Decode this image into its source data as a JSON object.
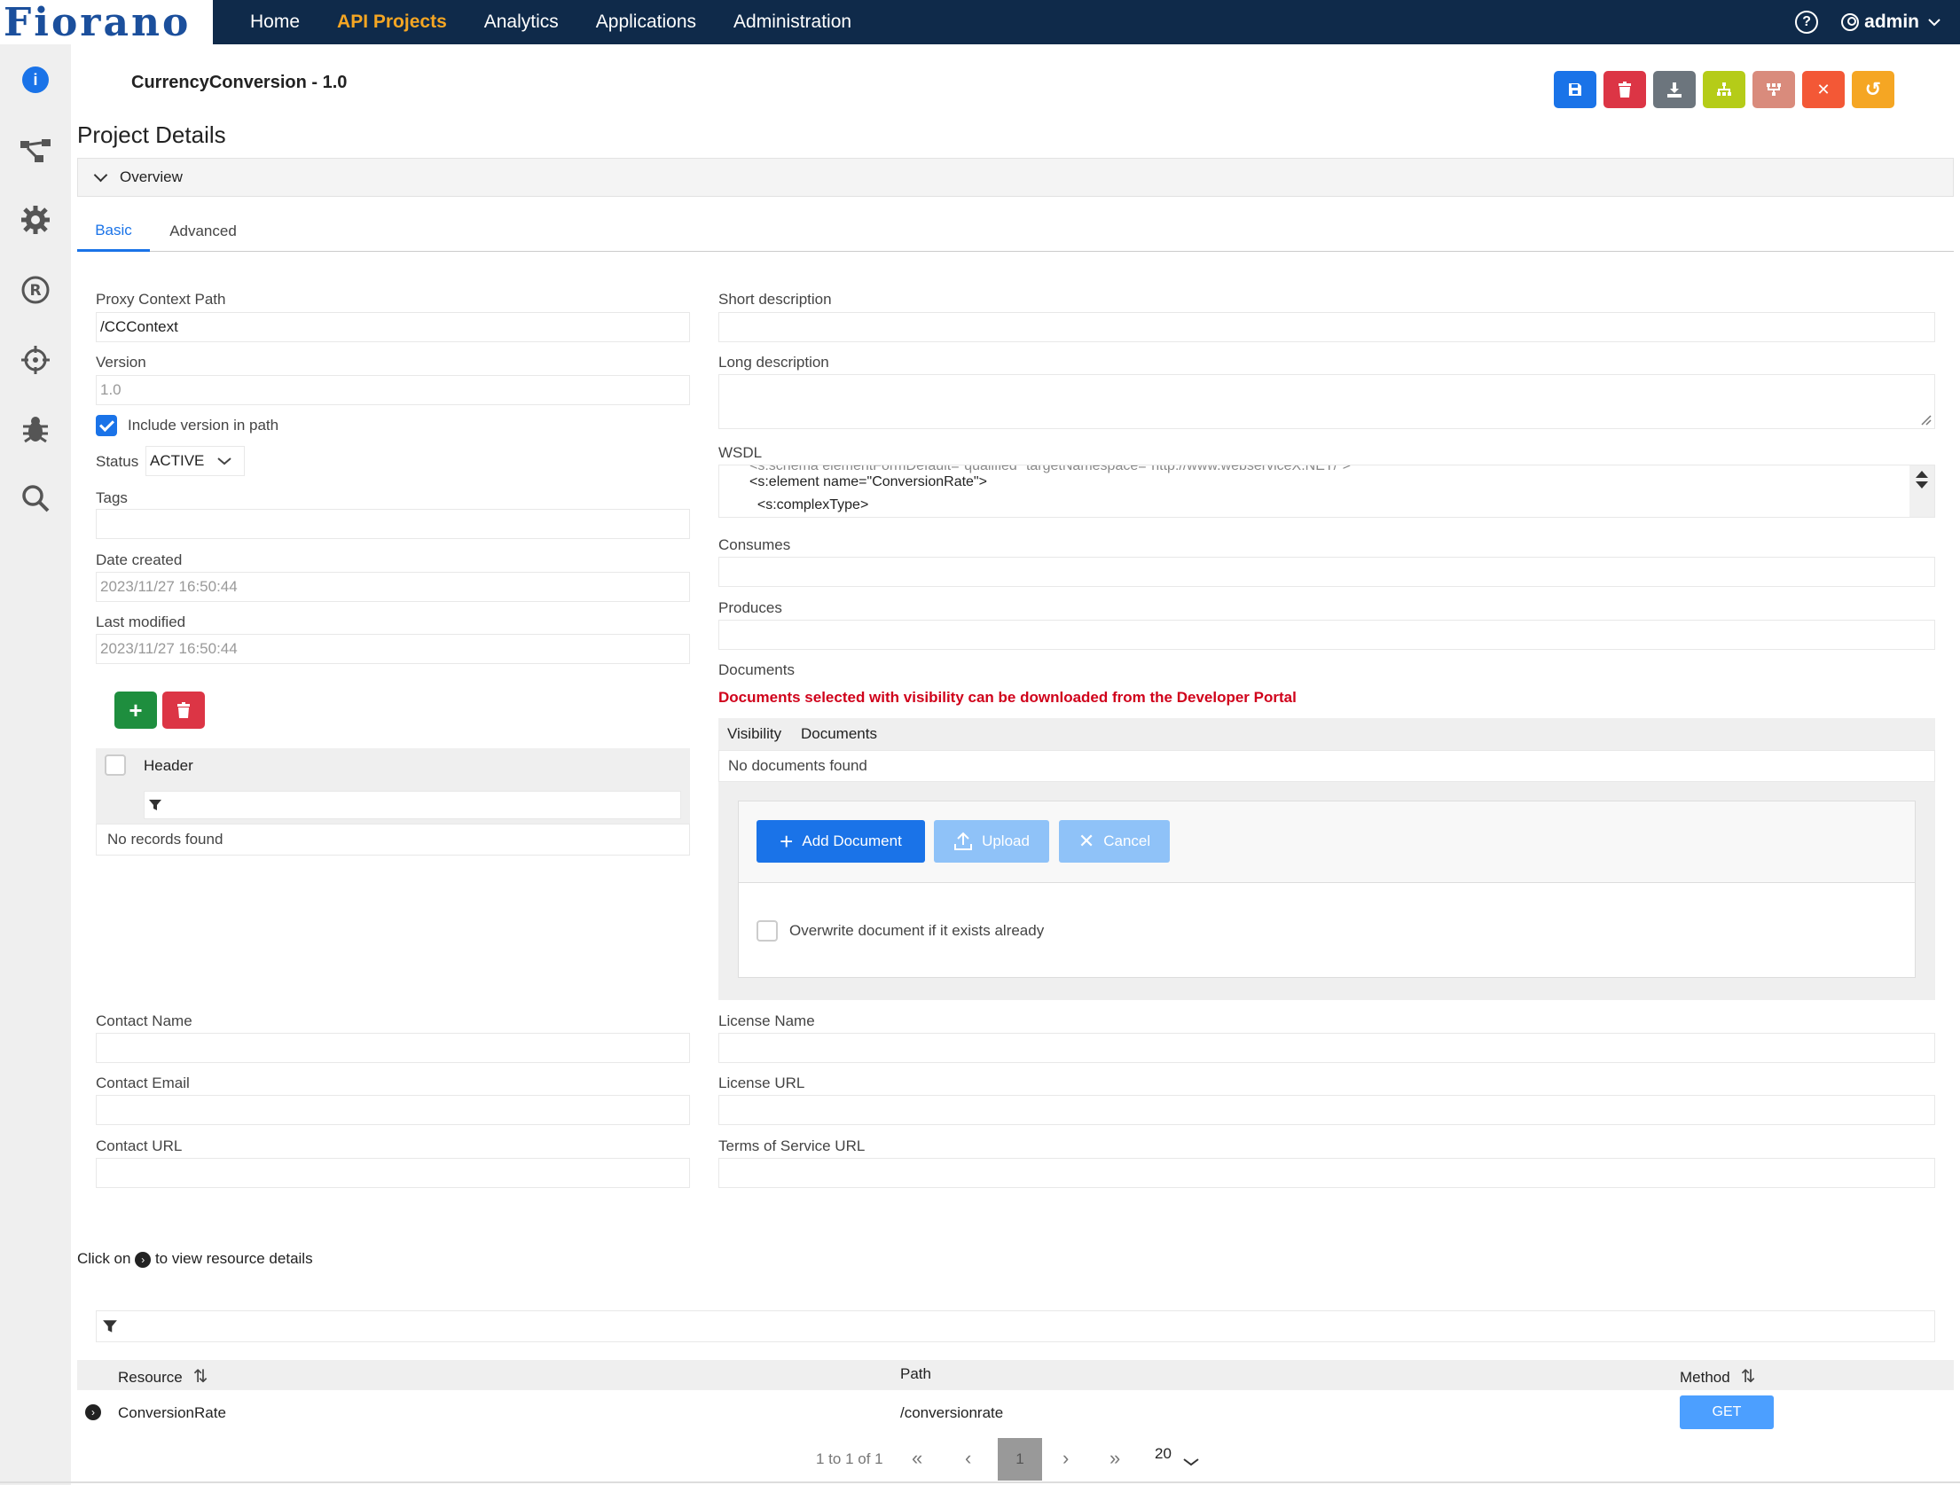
{
  "brand": {
    "logo_text": "Fiorano"
  },
  "nav": {
    "items": [
      "Home",
      "API Projects",
      "Analytics",
      "Applications",
      "Administration"
    ],
    "active": "API Projects",
    "help_icon": "?",
    "user": "admin"
  },
  "sidebar": {
    "icons": [
      "info-icon",
      "flow-icon",
      "gear-icon",
      "registered-icon",
      "crosshair-icon",
      "bug-icon",
      "search-icon"
    ]
  },
  "header": {
    "project_name": "CurrencyConversion - 1.0"
  },
  "toolbar": {
    "buttons": [
      {
        "name": "save-icon",
        "color": "#1a73e8"
      },
      {
        "name": "delete-icon",
        "color": "#dc3545"
      },
      {
        "name": "download-icon",
        "color": "#6c757d"
      },
      {
        "name": "hierarchy-icon",
        "color": "#b5cc18"
      },
      {
        "name": "deploy-icon",
        "color": "#d98b7c"
      },
      {
        "name": "close-icon",
        "color": "#f35836"
      },
      {
        "name": "undo-icon",
        "color": "#f5a623"
      }
    ]
  },
  "page": {
    "title": "Project Details",
    "overview_label": "Overview"
  },
  "tabs": {
    "basic": "Basic",
    "advanced": "Advanced"
  },
  "left": {
    "proxy_context_path_label": "Proxy Context Path",
    "proxy_context_path": "/CCContext",
    "version_label": "Version",
    "version": "1.0",
    "include_version_label": "Include version in path",
    "status_label": "Status",
    "status_value": "ACTIVE",
    "tags_label": "Tags",
    "date_created_label": "Date created",
    "date_created": "2023/11/27 16:50:44",
    "last_modified_label": "Last modified",
    "last_modified": "2023/11/27 16:50:44",
    "header_column": "Header",
    "no_records": "No records found"
  },
  "right": {
    "short_description_label": "Short description",
    "long_description_label": "Long description",
    "wsdl_label": "WSDL",
    "wsdl_lines": [
      "<s:element name=\"ConversionRate\">",
      "  <s:complexType>"
    ],
    "consumes_label": "Consumes",
    "produces_label": "Produces",
    "documents_label": "Documents",
    "documents_note": "Documents selected with visibility can be downloaded from the Developer Portal",
    "col_visibility": "Visibility",
    "col_documents": "Documents",
    "no_documents": "No documents found",
    "add_document": "Add Document",
    "upload": "Upload",
    "cancel": "Cancel",
    "overwrite_label": "Overwrite document if it exists already"
  },
  "contact": {
    "contact_name_label": "Contact Name",
    "contact_email_label": "Contact Email",
    "contact_url_label": "Contact URL",
    "license_name_label": "License Name",
    "license_url_label": "License URL",
    "tos_url_label": "Terms of Service URL"
  },
  "resources": {
    "hint_prefix": "Click on",
    "hint_suffix": "to view resource details",
    "columns": {
      "resource": "Resource",
      "path": "Path",
      "method": "Method"
    },
    "rows": [
      {
        "resource": "ConversionRate",
        "path": "/conversionrate",
        "method": "GET"
      }
    ],
    "pager": {
      "summary": "1 to 1 of 1",
      "page": "1",
      "page_size": "20"
    }
  }
}
